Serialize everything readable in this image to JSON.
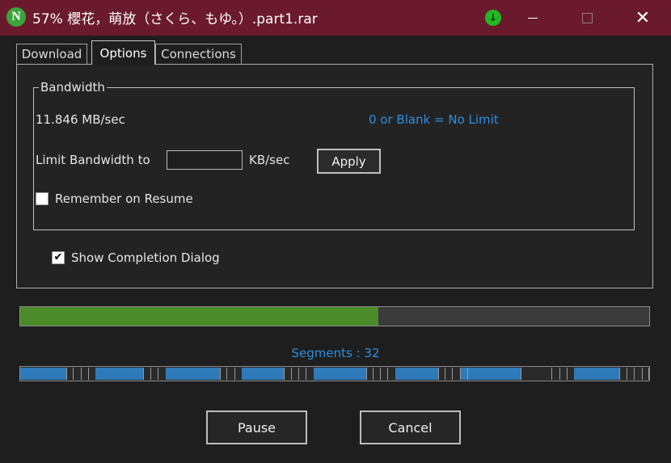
{
  "window": {
    "app_icon_letter": "N",
    "title": "57%  櫻花，萌放（さくら、もゆ。）.part1.rar",
    "download_indicator": "↓",
    "close_glyph": "✕"
  },
  "tabs": [
    {
      "label": "Download",
      "active": false
    },
    {
      "label": "Options",
      "active": true
    },
    {
      "label": "Connections",
      "active": false
    }
  ],
  "bandwidth": {
    "legend": "Bandwidth",
    "speed": "11.846 MB/sec",
    "hint": "0 or Blank = No Limit",
    "limit_label": "Limit Bandwidth to",
    "limit_value": "",
    "unit": "KB/sec",
    "apply_label": "Apply",
    "remember_label": "Remember on Resume",
    "remember_checked": false
  },
  "completion": {
    "label": "Show Completion Dialog",
    "checked": true,
    "check_glyph": "✔"
  },
  "progress": {
    "fraction": 0.57,
    "fill_color": "#4b8b2a"
  },
  "segments": {
    "label": "Segments : 32",
    "count": 32,
    "blocks": [
      {
        "start": 0.0,
        "end": 0.073
      },
      {
        "start": 0.084,
        "end": 0.085
      },
      {
        "start": 0.096,
        "end": 0.097
      },
      {
        "start": 0.108,
        "end": 0.109
      },
      {
        "start": 0.12,
        "end": 0.196
      },
      {
        "start": 0.207,
        "end": 0.208
      },
      {
        "start": 0.219,
        "end": 0.22
      },
      {
        "start": 0.231,
        "end": 0.317
      },
      {
        "start": 0.328,
        "end": 0.329
      },
      {
        "start": 0.34,
        "end": 0.341
      },
      {
        "start": 0.352,
        "end": 0.419
      },
      {
        "start": 0.43,
        "end": 0.431
      },
      {
        "start": 0.442,
        "end": 0.443
      },
      {
        "start": 0.454,
        "end": 0.455
      },
      {
        "start": 0.466,
        "end": 0.549
      },
      {
        "start": 0.56,
        "end": 0.561
      },
      {
        "start": 0.572,
        "end": 0.573
      },
      {
        "start": 0.584,
        "end": 0.585
      },
      {
        "start": 0.596,
        "end": 0.664
      },
      {
        "start": 0.675,
        "end": 0.676
      },
      {
        "start": 0.687,
        "end": 0.688
      },
      {
        "start": 0.699,
        "end": 0.7
      },
      {
        "start": 0.711,
        "end": 0.701
      },
      {
        "start": 0.712,
        "end": 0.795
      },
      {
        "start": 0.845,
        "end": 0.846
      },
      {
        "start": 0.857,
        "end": 0.858
      },
      {
        "start": 0.869,
        "end": 0.87
      },
      {
        "start": 0.881,
        "end": 0.953
      },
      {
        "start": 0.964,
        "end": 0.965
      },
      {
        "start": 0.976,
        "end": 0.977
      },
      {
        "start": 0.988,
        "end": 0.989
      },
      {
        "start": 0.999,
        "end": 1.0
      }
    ],
    "color": "#2f7ab8",
    "divider_color": "#9a9a9a"
  },
  "actions": {
    "pause_label": "Pause",
    "cancel_label": "Cancel"
  }
}
